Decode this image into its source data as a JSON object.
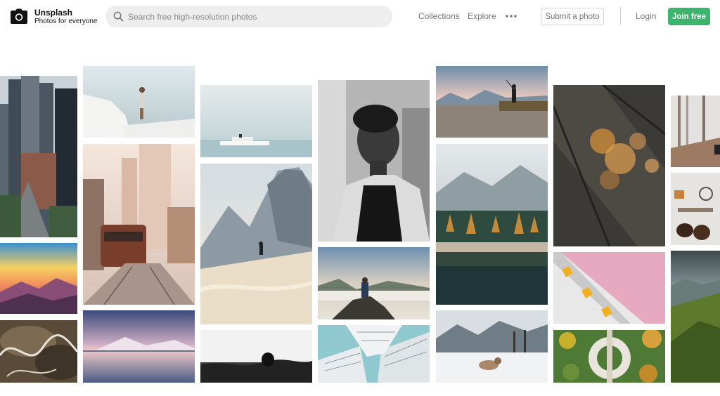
{
  "brand": {
    "name": "Unsplash",
    "tagline": "Photos for everyone"
  },
  "search": {
    "placeholder": "Search free high-resolution photos",
    "value": ""
  },
  "nav": {
    "collections": "Collections",
    "explore": "Explore"
  },
  "actions": {
    "submit_label": "Submit a photo",
    "login_label": "Login",
    "join_label": "Join free"
  },
  "colors": {
    "accent": "#3cb46e",
    "muted_text": "#767676",
    "search_bg": "#eeeeee"
  },
  "icons": {
    "logo": "camera-icon",
    "search": "search-icon",
    "more": "more-dots-icon"
  },
  "photos": [
    {
      "subject": "city-skyscrapers"
    },
    {
      "subject": "sunset-mountains"
    },
    {
      "subject": "winding-mountain-road"
    },
    {
      "subject": "woman-on-white-rooftop"
    },
    {
      "subject": "city-tram-street"
    },
    {
      "subject": "pink-sky-lake"
    },
    {
      "subject": "boat-on-misty-sea"
    },
    {
      "subject": "climber-half-dome"
    },
    {
      "subject": "swimmer-in-ocean"
    },
    {
      "subject": "bw-portrait-woman"
    },
    {
      "subject": "photographer-above-clouds"
    },
    {
      "subject": "building-looking-up"
    },
    {
      "subject": "fisherman-at-lake"
    },
    {
      "subject": "misty-forest-lake"
    },
    {
      "subject": "dog-in-snow"
    },
    {
      "subject": "rainy-window-bokeh"
    },
    {
      "subject": "pink-wall-building"
    },
    {
      "subject": "aerial-roundabout"
    },
    {
      "subject": "foggy-forest-path"
    },
    {
      "subject": "flatlay-shoes"
    },
    {
      "subject": "green-valley"
    }
  ]
}
